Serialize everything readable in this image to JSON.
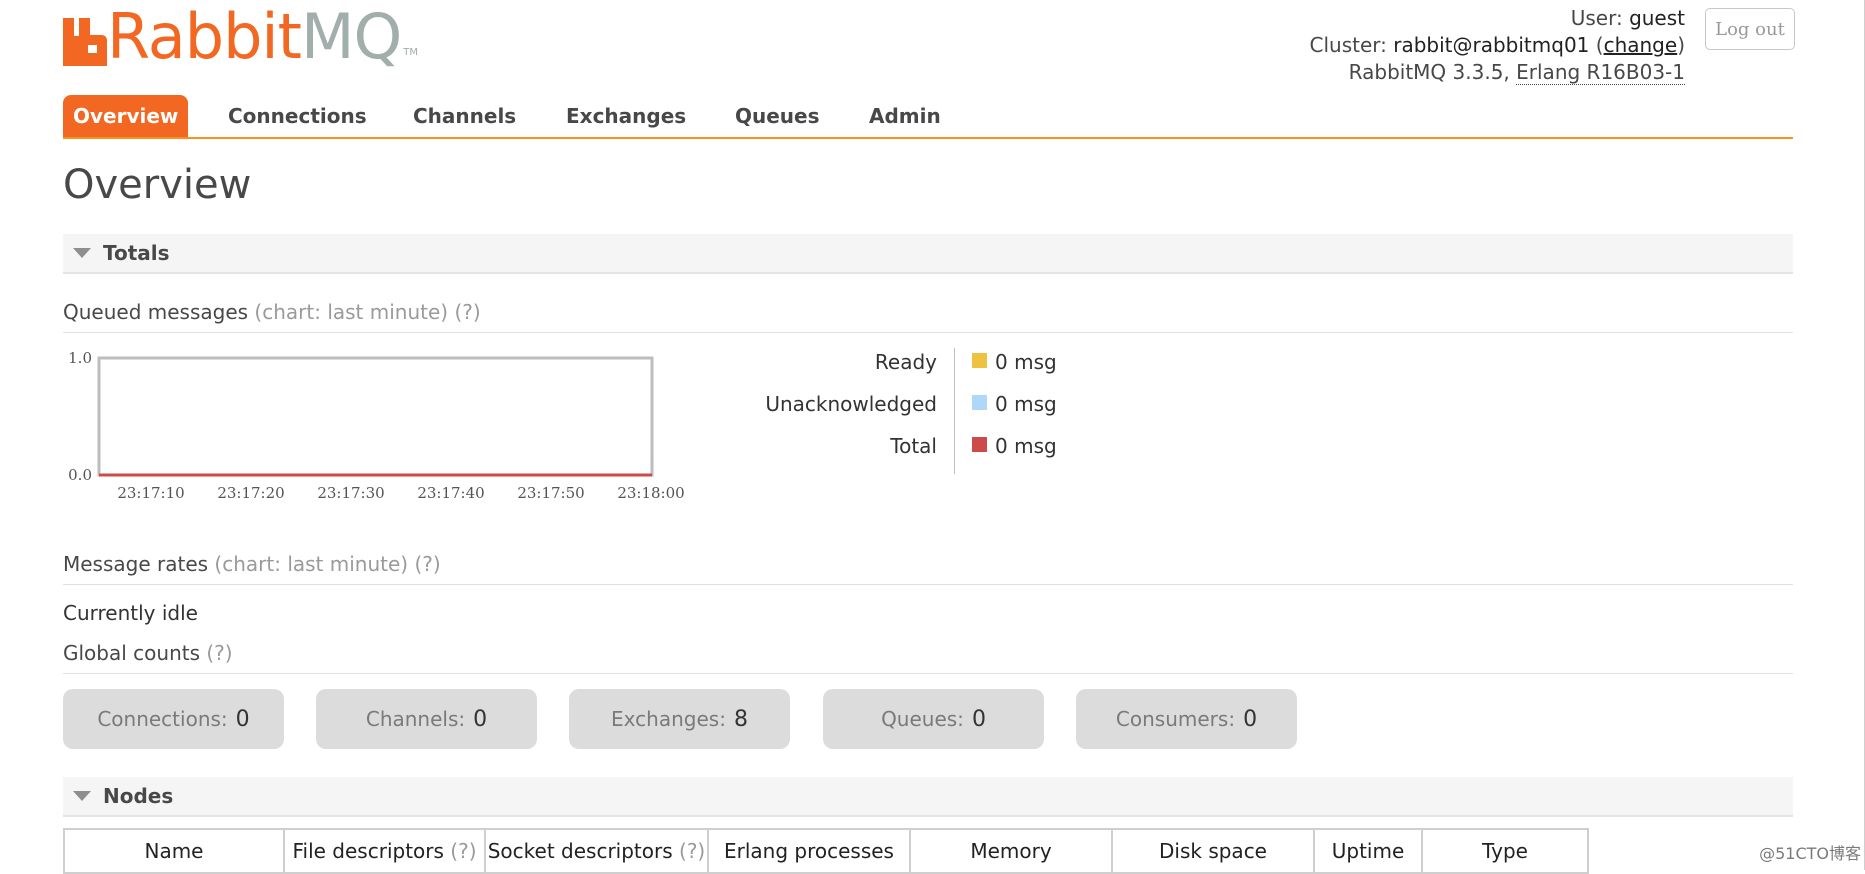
{
  "logo": {
    "text_left": "Rabbit",
    "text_right": "MQ",
    "trademark": "TM"
  },
  "header": {
    "user_label": "User:",
    "user_value": "guest",
    "cluster_label": "Cluster:",
    "cluster_value": "rabbit@rabbitmq01",
    "cluster_change": "change",
    "version_text": "RabbitMQ 3.3.5,",
    "erlang_text": "Erlang R16B03-1",
    "logout_label": "Log out"
  },
  "tabs": [
    {
      "label": "Overview",
      "active": true
    },
    {
      "label": "Connections",
      "active": false
    },
    {
      "label": "Channels",
      "active": false
    },
    {
      "label": "Exchanges",
      "active": false
    },
    {
      "label": "Queues",
      "active": false
    },
    {
      "label": "Admin",
      "active": false
    }
  ],
  "page_title": "Overview",
  "totals": {
    "title": "Totals",
    "queued_label": "Queued messages",
    "queued_hint": "(chart: last minute) (?)",
    "legend": [
      {
        "label": "Ready",
        "value": "0 msg",
        "color": "#edc240"
      },
      {
        "label": "Unacknowledged",
        "value": "0 msg",
        "color": "#afd8f8"
      },
      {
        "label": "Total",
        "value": "0 msg",
        "color": "#cb4b4b"
      }
    ],
    "rates_label": "Message rates",
    "rates_hint": "(chart: last minute) (?)",
    "rates_status": "Currently idle",
    "global_label": "Global counts",
    "global_hint": "(?)"
  },
  "chart_data": {
    "type": "line",
    "x": [
      "23:17:10",
      "23:17:20",
      "23:17:30",
      "23:17:40",
      "23:17:50",
      "23:18:00"
    ],
    "series": [
      {
        "name": "Ready",
        "values": [
          0,
          0,
          0,
          0,
          0,
          0
        ],
        "color": "#edc240"
      },
      {
        "name": "Unacknowledged",
        "values": [
          0,
          0,
          0,
          0,
          0,
          0
        ],
        "color": "#afd8f8"
      },
      {
        "name": "Total",
        "values": [
          0,
          0,
          0,
          0,
          0,
          0
        ],
        "color": "#cb4b4b"
      }
    ],
    "y_ticks": [
      "1.0",
      "0.0"
    ],
    "ylim": [
      0,
      1
    ]
  },
  "global_counts": [
    {
      "label": "Connections:",
      "value": "0"
    },
    {
      "label": "Channels:",
      "value": "0"
    },
    {
      "label": "Exchanges:",
      "value": "8"
    },
    {
      "label": "Queues:",
      "value": "0"
    },
    {
      "label": "Consumers:",
      "value": "0"
    }
  ],
  "nodes": {
    "title": "Nodes",
    "columns": [
      "Name",
      "File descriptors",
      "Socket descriptors",
      "Erlang processes",
      "Memory",
      "Disk space",
      "Uptime",
      "Type"
    ],
    "column_hints": [
      "",
      "(?)",
      "(?)",
      "",
      "",
      "",
      "",
      ""
    ]
  },
  "watermark": "@51CTO博客"
}
